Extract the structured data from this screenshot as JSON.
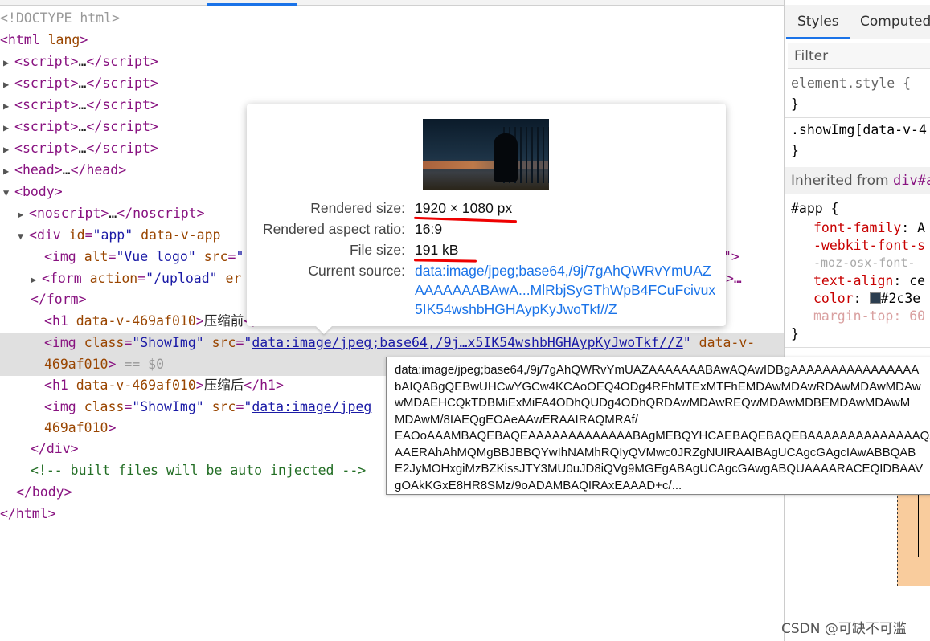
{
  "elements": {
    "doctype": "<!DOCTYPE html>",
    "html_open": "<html",
    "html_attr": " lang",
    "html_close_bracket": ">",
    "script_tag": "script",
    "ellipsis": "…",
    "head_tag": "head",
    "body_tag": "body",
    "noscript_tag": "noscript",
    "div_tag": "div",
    "div_id_attr": "id",
    "div_id_val": "app",
    "div_dv_attr": "data-v-app",
    "img_tag": "img",
    "img_alt_attr": "alt",
    "img_alt_val": "Vue logo",
    "img_src_attr": "src",
    "form_tag": "form",
    "form_action_attr": "action",
    "form_action_val": "/upload",
    "form_trunc": "er",
    "form_close": "</form>",
    "h1_tag": "h1",
    "h1_attr": "data-v-469af010",
    "h1_text_before": "压缩前",
    "h1_text_after": "压缩后",
    "img_class_attr": "class",
    "img_class_val": "ShowImg",
    "img_src_link_full": "data:image/jpeg;base64,/9j…x5IK54wshbHGHAypKyJwoTkf//Z",
    "img_src_link_short": "data:image/jpeg",
    "img_data_attr": "data-v-",
    "img_data_attr_cont": "469af010",
    "selected_marker": "== $0",
    "div_close": "</div>",
    "comment": "<!-- built files will be auto injected -->",
    "body_close": "</body>",
    "html_close": "</html>",
    "row2_trail_a": "\">",
    "row2_trail_b": ">…"
  },
  "styles": {
    "tab_styles": "Styles",
    "tab_computed": "Computed",
    "filter_placeholder": "Filter",
    "element_style": "element.style {",
    "close_brace": "}",
    "showimg_selector": ".showImg[data-v-4",
    "inherited_from": "Inherited from ",
    "inherited_el": "div#a",
    "app_selector": "#app {",
    "p1_name": "font-family",
    "p1_val": ": A",
    "p2_name": "-webkit-font-s",
    "p3_name": "-moz-osx-font-",
    "p4_name": "text-align",
    "p4_val": ": ce",
    "p5_name": "color",
    "p5_val": "#2c3e",
    "p6_name": "margin-top",
    "p6_val": ": 60",
    "swatch_color": "#2c3e50"
  },
  "popover": {
    "rendered_size_label": "Rendered size:",
    "rendered_size_value": "1920 × 1080 px",
    "aspect_label": "Rendered aspect ratio:",
    "aspect_value": "16:9",
    "file_size_label": "File size:",
    "file_size_value": "191 kB",
    "source_label": "Current source:",
    "source_value": "data:image/jpeg;base64,/9j/7gAhQWRvYmUAZAAAAAAABAwA...MlRbjSyGThWpB4FCuFcivux5IK54wshbHGHAypKyJwoTkf//Z"
  },
  "tooltip": {
    "lines": [
      "data:image/jpeg;base64,/9j/7gAhQWRvYmUAZAAAAAAABAwAQAwIDBgAAAAAAAAAAAAAAAA",
      "bAIQABgQEBwUHCwYGCw4KCAoOEQ4ODg4RFhMTExMTFhEMDAwMDAwRDAwMDAwMDAw",
      "wMDAEHCQkTDBMiExMiFA4ODhQUDg4ODhQRDAwMDAwREQwMDAwMDBEMDAwMDAwM",
      "MDAwM/8IAEQgEOAeAAwERAAIRAQMRAf/",
      "EAOoAAAMBAQEBAQEAAAAAAAAAAAAABAgMEBQYHCAEBAQEBAQEBAAAAAAAAAAAAAAQA",
      "AAERAhAhMQMgBBJBBQYwIhNAMhRQIyQVMwc0JRZgNUIRAAIBAgUCAgcGAgcIAwABBQAB",
      "E2JyMOHxgiMzBZKissJTY3MU0uJD8iQVg9MGEgABAgUCAgcGAwgABQUAAAARACEQIDBAAV",
      "gOAkKGxE8HR8SMz/9oADAMBAQIRAxEAAAD+c/..."
    ]
  },
  "watermark": "CSDN @可缺不可滥"
}
